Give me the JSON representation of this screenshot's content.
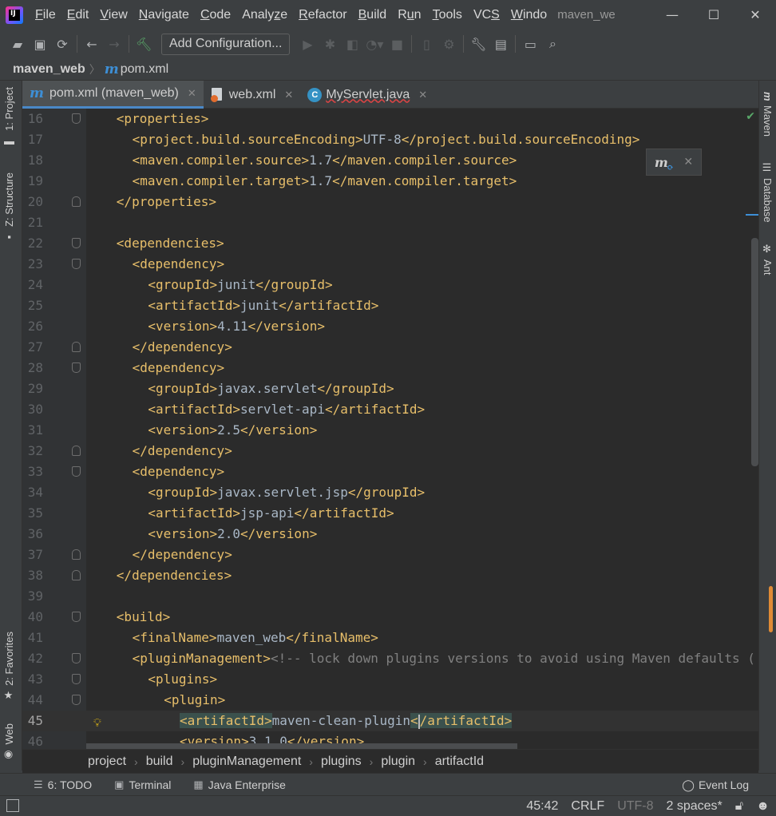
{
  "menubar": {
    "items": [
      {
        "label": "File"
      },
      {
        "label": "Edit"
      },
      {
        "label": "View"
      },
      {
        "label": "Navigate"
      },
      {
        "label": "Code"
      },
      {
        "label": "Analyze"
      },
      {
        "label": "Refactor"
      },
      {
        "label": "Build"
      },
      {
        "label": "Run"
      },
      {
        "label": "Tools"
      },
      {
        "label": "VCS"
      },
      {
        "label": "Windo"
      }
    ],
    "window_title": "maven_we"
  },
  "toolbar": {
    "add_configuration": "Add Configuration..."
  },
  "navbar": {
    "project": "maven_web",
    "file": "pom.xml"
  },
  "left_tools": {
    "project": "1: Project",
    "structure": "Z: Structure",
    "favorites": "2: Favorites",
    "web": "Web"
  },
  "right_tools": {
    "maven": "Maven",
    "database": "Database",
    "ant": "Ant"
  },
  "tabs": [
    {
      "label": "pom.xml (maven_web)",
      "active": true
    },
    {
      "label": "web.xml",
      "active": false
    },
    {
      "label": "MyServlet.java",
      "active": false
    }
  ],
  "editor": {
    "lines": [
      {
        "num": "16",
        "indent": 2,
        "html": "<span class='tag'>&lt;properties&gt;</span>"
      },
      {
        "num": "17",
        "indent": 4,
        "html": "<span class='tag'>&lt;project.build.sourceEncoding&gt;</span>UTF-8<span class='tag'>&lt;/project.build.sourceEncoding&gt;</span>"
      },
      {
        "num": "18",
        "indent": 4,
        "html": "<span class='tag'>&lt;maven.compiler.source&gt;</span>1.7<span class='tag'>&lt;/maven.compiler.source&gt;</span>"
      },
      {
        "num": "19",
        "indent": 4,
        "html": "<span class='tag'>&lt;maven.compiler.target&gt;</span>1.7<span class='tag'>&lt;/maven.compiler.target&gt;</span>"
      },
      {
        "num": "20",
        "indent": 2,
        "html": "<span class='tag'>&lt;/properties&gt;</span>"
      },
      {
        "num": "21",
        "indent": 0,
        "html": ""
      },
      {
        "num": "22",
        "indent": 2,
        "html": "<span class='tag'>&lt;dependencies&gt;</span>"
      },
      {
        "num": "23",
        "indent": 4,
        "html": "<span class='tag'>&lt;dependency&gt;</span>"
      },
      {
        "num": "24",
        "indent": 6,
        "html": "<span class='tag'>&lt;groupId&gt;</span>junit<span class='tag'>&lt;/groupId&gt;</span>"
      },
      {
        "num": "25",
        "indent": 6,
        "html": "<span class='tag'>&lt;artifactId&gt;</span>junit<span class='tag'>&lt;/artifactId&gt;</span>"
      },
      {
        "num": "26",
        "indent": 6,
        "html": "<span class='tag'>&lt;version&gt;</span>4.11<span class='tag'>&lt;/version&gt;</span>"
      },
      {
        "num": "27",
        "indent": 4,
        "html": "<span class='tag'>&lt;/dependency&gt;</span>"
      },
      {
        "num": "28",
        "indent": 4,
        "html": "<span class='tag'>&lt;dependency&gt;</span>"
      },
      {
        "num": "29",
        "indent": 6,
        "html": "<span class='tag'>&lt;groupId&gt;</span>javax.servlet<span class='tag'>&lt;/groupId&gt;</span>"
      },
      {
        "num": "30",
        "indent": 6,
        "html": "<span class='tag'>&lt;artifactId&gt;</span>servlet-api<span class='tag'>&lt;/artifactId&gt;</span>"
      },
      {
        "num": "31",
        "indent": 6,
        "html": "<span class='tag'>&lt;version&gt;</span>2.5<span class='tag'>&lt;/version&gt;</span>"
      },
      {
        "num": "32",
        "indent": 4,
        "html": "<span class='tag'>&lt;/dependency&gt;</span>"
      },
      {
        "num": "33",
        "indent": 4,
        "html": "<span class='tag'>&lt;dependency&gt;</span>"
      },
      {
        "num": "34",
        "indent": 6,
        "html": "<span class='tag'>&lt;groupId&gt;</span>javax.servlet.jsp<span class='tag'>&lt;/groupId&gt;</span>"
      },
      {
        "num": "35",
        "indent": 6,
        "html": "<span class='tag'>&lt;artifactId&gt;</span>jsp-api<span class='tag'>&lt;/artifactId&gt;</span>"
      },
      {
        "num": "36",
        "indent": 6,
        "html": "<span class='tag'>&lt;version&gt;</span>2.0<span class='tag'>&lt;/version&gt;</span>"
      },
      {
        "num": "37",
        "indent": 4,
        "html": "<span class='tag'>&lt;/dependency&gt;</span>"
      },
      {
        "num": "38",
        "indent": 2,
        "html": "<span class='tag'>&lt;/dependencies&gt;</span>"
      },
      {
        "num": "39",
        "indent": 0,
        "html": ""
      },
      {
        "num": "40",
        "indent": 2,
        "html": "<span class='tag'>&lt;build&gt;</span>"
      },
      {
        "num": "41",
        "indent": 4,
        "html": "<span class='tag'>&lt;finalName&gt;</span>maven_web<span class='tag'>&lt;/finalName&gt;</span>"
      },
      {
        "num": "42",
        "indent": 4,
        "html": "<span class='tag'>&lt;pluginManagement&gt;</span><span class='cmt'>&lt;!-- lock down plugins versions to avoid using Maven defaults (</span>"
      },
      {
        "num": "43",
        "indent": 6,
        "html": "<span class='tag'>&lt;plugins&gt;</span>"
      },
      {
        "num": "44",
        "indent": 8,
        "html": "<span class='tag'>&lt;plugin&gt;</span>"
      },
      {
        "num": "45",
        "indent": 10,
        "html": "<span class='tag hl'>&lt;artifactId&gt;</span>maven-clean-plugin<span class='tag hl'>&lt;<span class='caret'></span>/artifactId&gt;</span>",
        "current": true
      },
      {
        "num": "46",
        "indent": 10,
        "html": "<span class='tag'>&lt;version&gt;</span>3.1.0<span class='tag'>&lt;/version&gt;</span>"
      }
    ]
  },
  "structure_breadcrumb": [
    "project",
    "build",
    "pluginManagement",
    "plugins",
    "plugin",
    "artifactId"
  ],
  "bottom_tools": {
    "todo": "6: TODO",
    "terminal": "Terminal",
    "java_enterprise": "Java Enterprise",
    "event_log": "Event Log"
  },
  "statusbar": {
    "position": "45:42",
    "line_sep": "CRLF",
    "encoding": "UTF-8",
    "indent": "2 spaces*"
  }
}
